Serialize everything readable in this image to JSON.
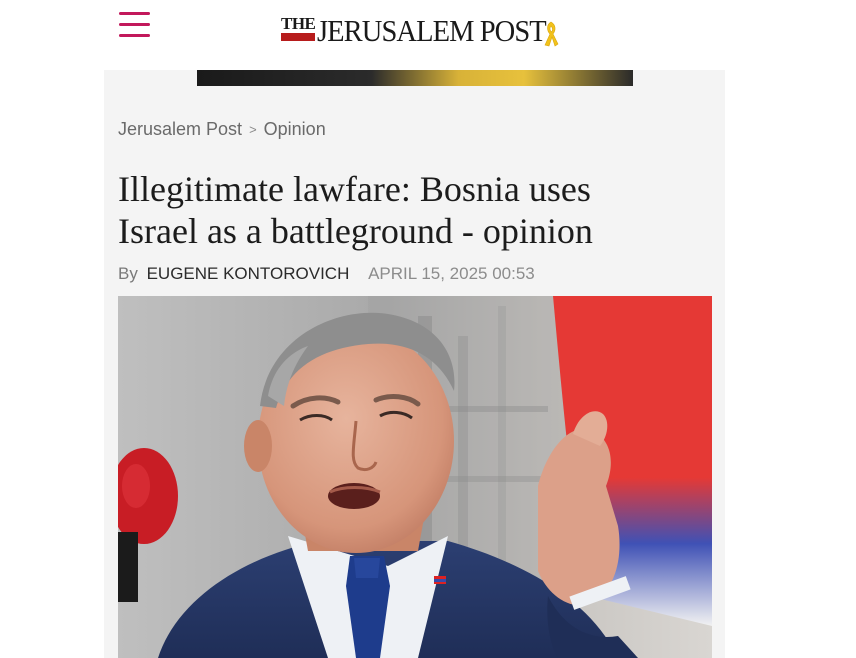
{
  "header": {
    "logo_the": "THE",
    "logo_name": "JERUSALEM POST"
  },
  "breadcrumb": {
    "home": "Jerusalem Post",
    "separator": ">",
    "section": "Opinion"
  },
  "article": {
    "headline_line1": "Illegitimate lawfare: Bosnia uses",
    "headline_line2": "Israel as a battleground - opinion",
    "by": "By",
    "author": "EUGENE KONTOROVICH",
    "date": "APRIL 15, 2025 00:53"
  },
  "icons": {
    "menu": "hamburger-menu-icon",
    "ribbon": "yellow-ribbon-icon"
  },
  "colors": {
    "menu_accent": "#c2185b",
    "logo_bar": "#b71c1c",
    "ribbon": "#f2c21b"
  }
}
